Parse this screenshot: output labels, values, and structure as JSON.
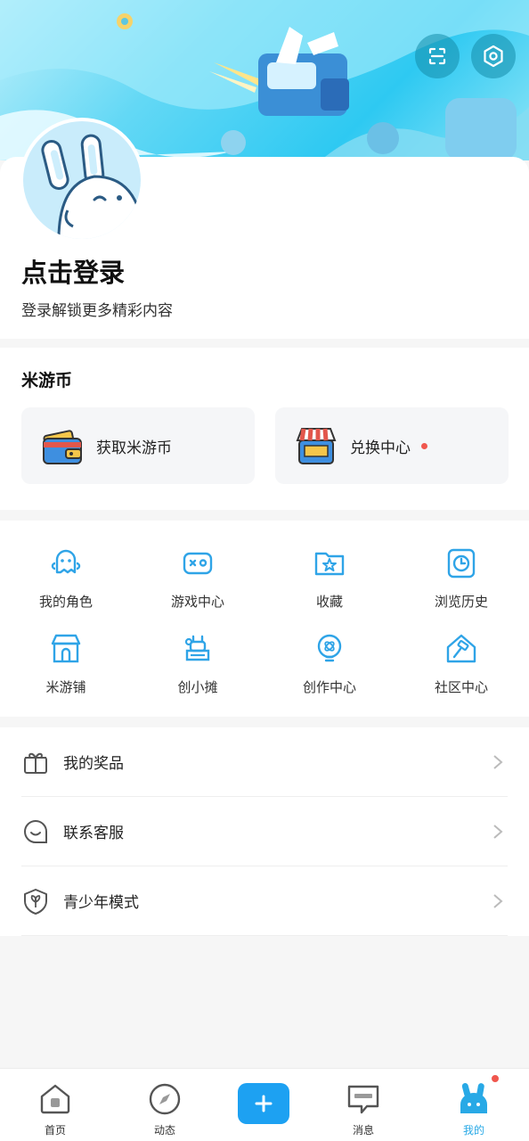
{
  "profile": {
    "login_title": "点击登录",
    "login_subtitle": "登录解锁更多精彩内容"
  },
  "coins": {
    "title": "米游币",
    "get_label": "获取米游币",
    "exchange_label": "兑换中心",
    "exchange_has_dot": true
  },
  "grid": {
    "items": [
      {
        "label": "我的角色",
        "icon": "character-icon"
      },
      {
        "label": "游戏中心",
        "icon": "gamepad-icon"
      },
      {
        "label": "收藏",
        "icon": "favorite-folder-icon"
      },
      {
        "label": "浏览历史",
        "icon": "history-clock-icon"
      },
      {
        "label": "米游铺",
        "icon": "shop-icon"
      },
      {
        "label": "创小摊",
        "icon": "stall-icon"
      },
      {
        "label": "创作中心",
        "icon": "creator-bulb-icon"
      },
      {
        "label": "社区中心",
        "icon": "community-hammer-icon"
      }
    ]
  },
  "list": {
    "items": [
      {
        "label": "我的奖品",
        "icon": "gift-icon"
      },
      {
        "label": "联系客服",
        "icon": "customer-service-icon"
      },
      {
        "label": "青少年模式",
        "icon": "youth-shield-icon"
      }
    ]
  },
  "tabbar": {
    "home": "首页",
    "feed": "动态",
    "messages": "消息",
    "mine": "我的",
    "mine_has_dot": true
  },
  "colors": {
    "accent": "#28a9e6",
    "icon_blue": "#2fa4e7",
    "badge_red": "#f0574e",
    "plus_button": "#1da1f2"
  }
}
